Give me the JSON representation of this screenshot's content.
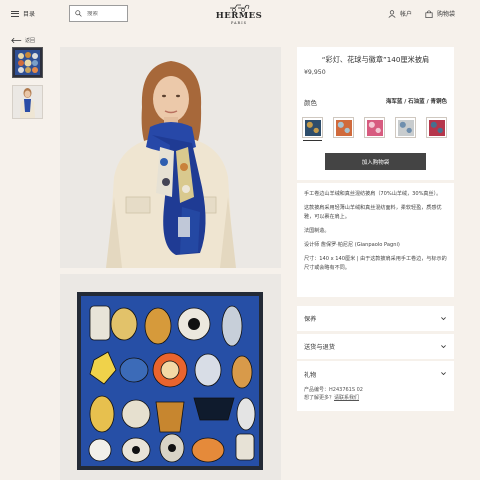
{
  "header": {
    "menu_label": "目录",
    "search_placeholder": "搜索",
    "brand": "HERMES",
    "brand_city": "PARIS",
    "account_label": "帐户",
    "cart_label": "购物袋"
  },
  "back_label": "返回",
  "product": {
    "title": "“彩灯、花球与徽章”140厘米披肩",
    "price": "¥9,950",
    "color_label": "颜色",
    "color_value": "海军蓝 / 石油蓝 / 青铜色",
    "swatches": [
      {
        "name": "海军蓝 / 石油蓝 / 青铜色",
        "color": "#2e4d6b",
        "accent": "#c59b4a"
      },
      {
        "name": "橙色",
        "color": "#d06a3c",
        "accent": "#a7c2d0"
      },
      {
        "name": "粉色",
        "color": "#d75b7f",
        "accent": "#f3c7d3"
      },
      {
        "name": "浅灰",
        "color": "#c8ccce",
        "accent": "#6f8fae"
      },
      {
        "name": "红色",
        "color": "#b5364b",
        "accent": "#46708f"
      }
    ],
    "add_to_cart": "加入购物袋",
    "desc": [
      "手工卷边山羊绒和真丝混纺披肩（70%山羊绒，30%真丝）。",
      "这款披肩采用轻薄山羊绒和真丝混纺面料，柔软轻盈，质感优雅，可以裹在肩上。",
      "法国制造。",
      "设计师 詹保罗·帕尼尼 (Gianpaolo Pagni)",
      "尺寸：140 x 140厘米 | 由于这款披肩采用手工卷边，与标示的尺寸或会略有不同。"
    ]
  },
  "accordions": [
    "保养",
    "送货与退货",
    "礼物"
  ],
  "reference": {
    "code_label": "产品编号：",
    "code": "H243761S 02",
    "help_label": "想了解更多？",
    "help_link": "请联系我们"
  }
}
